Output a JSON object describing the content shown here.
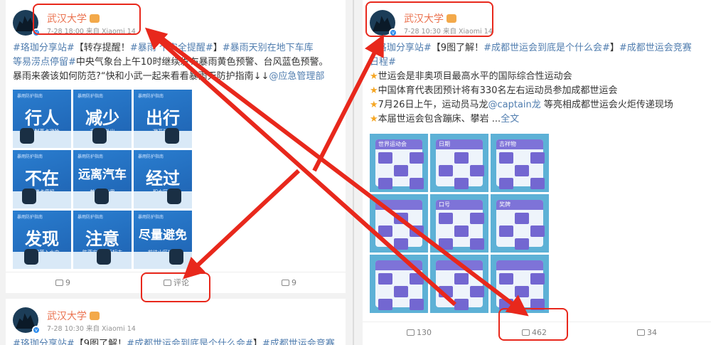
{
  "left_post": {
    "author": "武汉大学",
    "meta": "7-28 18:00 来自 Xiaomi 14",
    "text_lines": [
      [
        {
          "t": "#珞珈分享站#",
          "k": "tag"
        },
        {
          "t": "【转存提醒！",
          "k": "plain"
        },
        {
          "t": "#暴雨",
          "k": "tag"
        },
        {
          "t": "     个安全提醒#",
          "k": "tag"
        },
        {
          "t": "】",
          "k": "plain"
        },
        {
          "t": "#暴雨天别在地下车库",
          "k": "tag"
        }
      ],
      [
        {
          "t": "等易涝点停留#",
          "k": "tag"
        },
        {
          "t": "中央气象台上午10时继续发布暴雨黄色预警、台风蓝色预警。",
          "k": "plain"
        }
      ],
      [
        {
          "t": "暴雨来袭该如何防范?“快和小武一起来看看暴雨天防护指南↓↓",
          "k": "plain"
        },
        {
          "t": "@应急管理部",
          "k": "link"
        }
      ]
    ],
    "tiles": [
      {
        "caption": "暴雨防护指南",
        "big": "行人",
        "small": "寻找制高点避险"
      },
      {
        "caption": "暴雨防护指南",
        "big": "减少",
        "small": "非必要外出"
      },
      {
        "caption": "暴雨防护指南",
        "big": "出行",
        "small": "避开漩涡"
      },
      {
        "caption": "暴雨防护指南",
        "big": "不在",
        "small": "易涝点停留"
      },
      {
        "caption": "暴雨防护指南",
        "big": "远离汽车",
        "small": "若被困车里"
      },
      {
        "caption": "暴雨防护指南",
        "big": "经过",
        "small": "积水区域"
      },
      {
        "caption": "暴雨防护指南",
        "big": "发现",
        "small": "有电线落入水中"
      },
      {
        "caption": "暴雨防护指南",
        "big": "注意",
        "small": "防范安全警示标志"
      },
      {
        "caption": "暴雨防护指南",
        "big": "尽量避免",
        "small": "前往山区旅游"
      }
    ],
    "actions": {
      "repost": "9",
      "comment": "评论",
      "like": "9"
    }
  },
  "left_post_2": {
    "author": "武汉大学",
    "meta": "7-28 10:30 来自 Xiaomi 14",
    "text": [
      {
        "t": "#珞珈分享站#",
        "k": "tag"
      },
      {
        "t": "【9图了解！",
        "k": "plain"
      },
      {
        "t": "#成都世运会到底是个什么会#",
        "k": "tag"
      },
      {
        "t": "】",
        "k": "plain"
      },
      {
        "t": "#成都世运会竞赛",
        "k": "tag"
      }
    ]
  },
  "right_post": {
    "author": "武汉大学",
    "meta": "7-28 10:30 来自 Xiaomi 14",
    "text_lines": [
      [
        {
          "t": "#珞珈分享站#",
          "k": "tag"
        },
        {
          "t": "【9图了解！",
          "k": "plain"
        },
        {
          "t": "#成都世运会到底是个什么会#",
          "k": "tag"
        },
        {
          "t": "】",
          "k": "plain"
        },
        {
          "t": "#成都世运会竞赛",
          "k": "tag"
        }
      ],
      [
        {
          "t": "日程#",
          "k": "tag"
        }
      ],
      [
        {
          "t": "★",
          "k": "star"
        },
        {
          "t": "世运会是非奥项目最高水平的国际综合性运动会",
          "k": "plain"
        }
      ],
      [
        {
          "t": "★",
          "k": "star"
        },
        {
          "t": "中国体育代表团预计将有330名左右运动员参加成都世运会",
          "k": "plain"
        }
      ],
      [
        {
          "t": "★",
          "k": "star"
        },
        {
          "t": "7月26日上午，运动员马龙",
          "k": "plain"
        },
        {
          "t": "@captain龙",
          "k": "link"
        },
        {
          "t": " 等亮相成都世运会火炬传递现场",
          "k": "plain"
        }
      ],
      [
        {
          "t": "★",
          "k": "star"
        },
        {
          "t": "本届世运会包含蹦床、攀岩 ...",
          "k": "plain"
        },
        {
          "t": "全文",
          "k": "link"
        }
      ]
    ],
    "tile_labels": [
      "世界运动会",
      "日期",
      "吉祥物",
      "",
      "口号",
      "奖牌",
      "",
      "",
      "",
      "",
      "",
      ""
    ],
    "actions": {
      "repost": "130",
      "comment": "462",
      "like": "34"
    }
  },
  "colors": {
    "annotation": "#e8281c",
    "author_name": "#eb7350",
    "hashtag": "#507daf",
    "star": "#f5a623"
  }
}
